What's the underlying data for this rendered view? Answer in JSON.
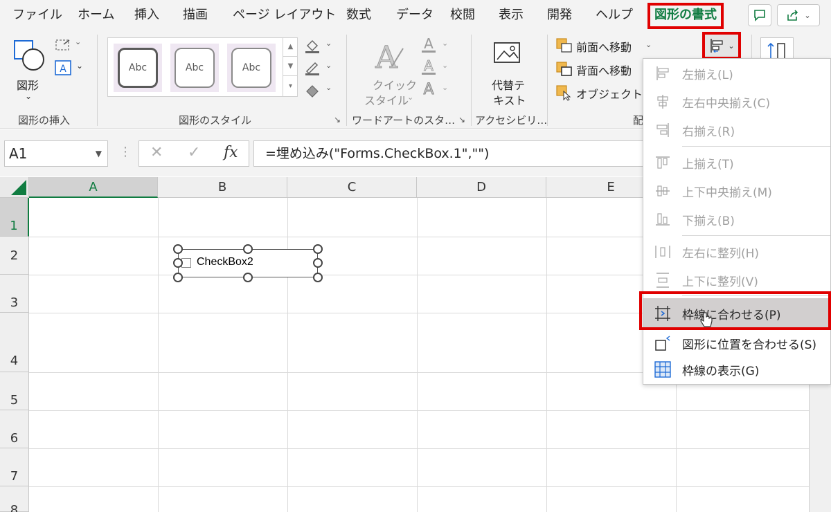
{
  "tabs": [
    {
      "id": "file",
      "label": "ファイル"
    },
    {
      "id": "home",
      "label": "ホーム"
    },
    {
      "id": "insert",
      "label": "挿入"
    },
    {
      "id": "draw",
      "label": "描画"
    },
    {
      "id": "page_layout",
      "label": "ページ レイアウト"
    },
    {
      "id": "formulas",
      "label": "数式"
    },
    {
      "id": "data",
      "label": "データ"
    },
    {
      "id": "review",
      "label": "校閲"
    },
    {
      "id": "view",
      "label": "表示"
    },
    {
      "id": "developer",
      "label": "開発"
    },
    {
      "id": "help",
      "label": "ヘルプ"
    },
    {
      "id": "shape_format",
      "label": "図形の書式",
      "active": true
    }
  ],
  "ribbon": {
    "insert_shapes": {
      "shape_label": "図形",
      "group_label": "図形の挿入"
    },
    "shape_styles": {
      "swatches": [
        "Abc",
        "Abc",
        "Abc"
      ],
      "group_label": "図形のスタイル"
    },
    "wordart": {
      "quick_styles_line1": "クイック",
      "quick_styles_line2": "スタイル",
      "group_label": "ワードアートのスタ…"
    },
    "accessibility": {
      "alt_text_line1": "代替テ",
      "alt_text_line2": "キスト",
      "group_label": "アクセシビリ…"
    },
    "arrange": {
      "bring_forward": "前面へ移動",
      "send_backward": "背面へ移動",
      "selection_pane": "オブジェクトの選",
      "group_label_partial": "配"
    }
  },
  "formula_bar": {
    "name_box": "A1",
    "formula": "=埋め込み(\"Forms.CheckBox.1\",\"\")"
  },
  "sheet": {
    "columns": [
      "A",
      "B",
      "C",
      "D",
      "E"
    ],
    "rows": [
      "1",
      "2",
      "3",
      "4",
      "5",
      "6",
      "7",
      "8"
    ],
    "checkbox_label": "CheckBox2"
  },
  "align_menu": {
    "items": [
      {
        "label": "左揃え(L)",
        "icon": "align-left-icon",
        "enabled": false
      },
      {
        "label": "左右中央揃え(C)",
        "icon": "align-center-icon",
        "enabled": false
      },
      {
        "label": "右揃え(R)",
        "icon": "align-right-icon",
        "enabled": false
      },
      {
        "label": "上揃え(T)",
        "icon": "align-top-icon",
        "enabled": false
      },
      {
        "label": "上下中央揃え(M)",
        "icon": "align-middle-icon",
        "enabled": false
      },
      {
        "label": "下揃え(B)",
        "icon": "align-bottom-icon",
        "enabled": false
      },
      {
        "label": "左右に整列(H)",
        "icon": "distribute-horizontal-icon",
        "enabled": false
      },
      {
        "label": "上下に整列(V)",
        "icon": "distribute-vertical-icon",
        "enabled": false
      },
      {
        "label": "枠線に合わせる(P)",
        "icon": "snap-to-grid-icon",
        "enabled": true,
        "hovered": true
      },
      {
        "label": "図形に位置を合わせる(S)",
        "icon": "snap-to-shape-icon",
        "enabled": true
      },
      {
        "label": "枠線の表示(G)",
        "icon": "view-gridlines-icon",
        "enabled": true
      }
    ]
  },
  "colors": {
    "accent_green": "#107c41",
    "highlight_red": "#e00000"
  }
}
